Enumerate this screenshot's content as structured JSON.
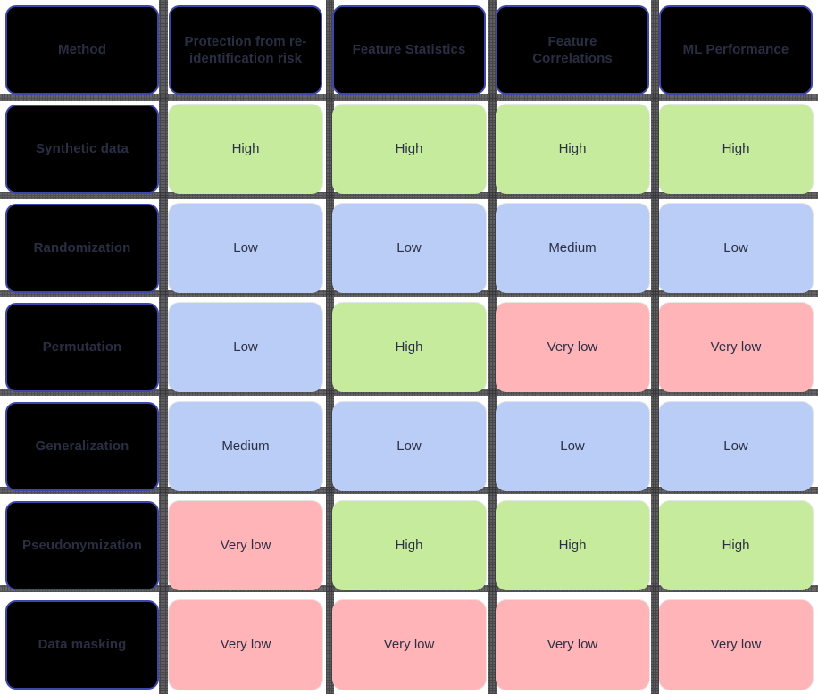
{
  "table": {
    "corner_label": "Method",
    "column_headers": [
      "Protection from re-identification risk",
      "Feature Statistics",
      "Feature Correlations",
      "ML Performance"
    ],
    "row_labels": [
      "Synthetic data",
      "Randomization",
      "Permutation",
      "Generalization",
      "Pseudonymization",
      "Data masking"
    ],
    "rows": [
      {
        "method": "Synthetic data",
        "values": [
          "High",
          "High",
          "High",
          "High"
        ]
      },
      {
        "method": "Randomization",
        "values": [
          "Low",
          "Low",
          "Medium",
          "Low"
        ]
      },
      {
        "method": "Permutation",
        "values": [
          "Low",
          "High",
          "Very low",
          "Very low"
        ]
      },
      {
        "method": "Generalization",
        "values": [
          "Medium",
          "Low",
          "Low",
          "Low"
        ]
      },
      {
        "method": "Pseudonymization",
        "values": [
          "Very low",
          "High",
          "High",
          "High"
        ]
      },
      {
        "method": "Data masking",
        "values": [
          "Very low",
          "Very low",
          "Very low",
          "Very low"
        ]
      }
    ]
  },
  "legend_colors": {
    "high": "#c6eb9d",
    "medium": "#bacdf6",
    "low": "#bacdf6",
    "very_low": "#ffb4b8",
    "header_fill": "#000000",
    "header_border": "#3d46ab",
    "text": "#2b2f45"
  }
}
